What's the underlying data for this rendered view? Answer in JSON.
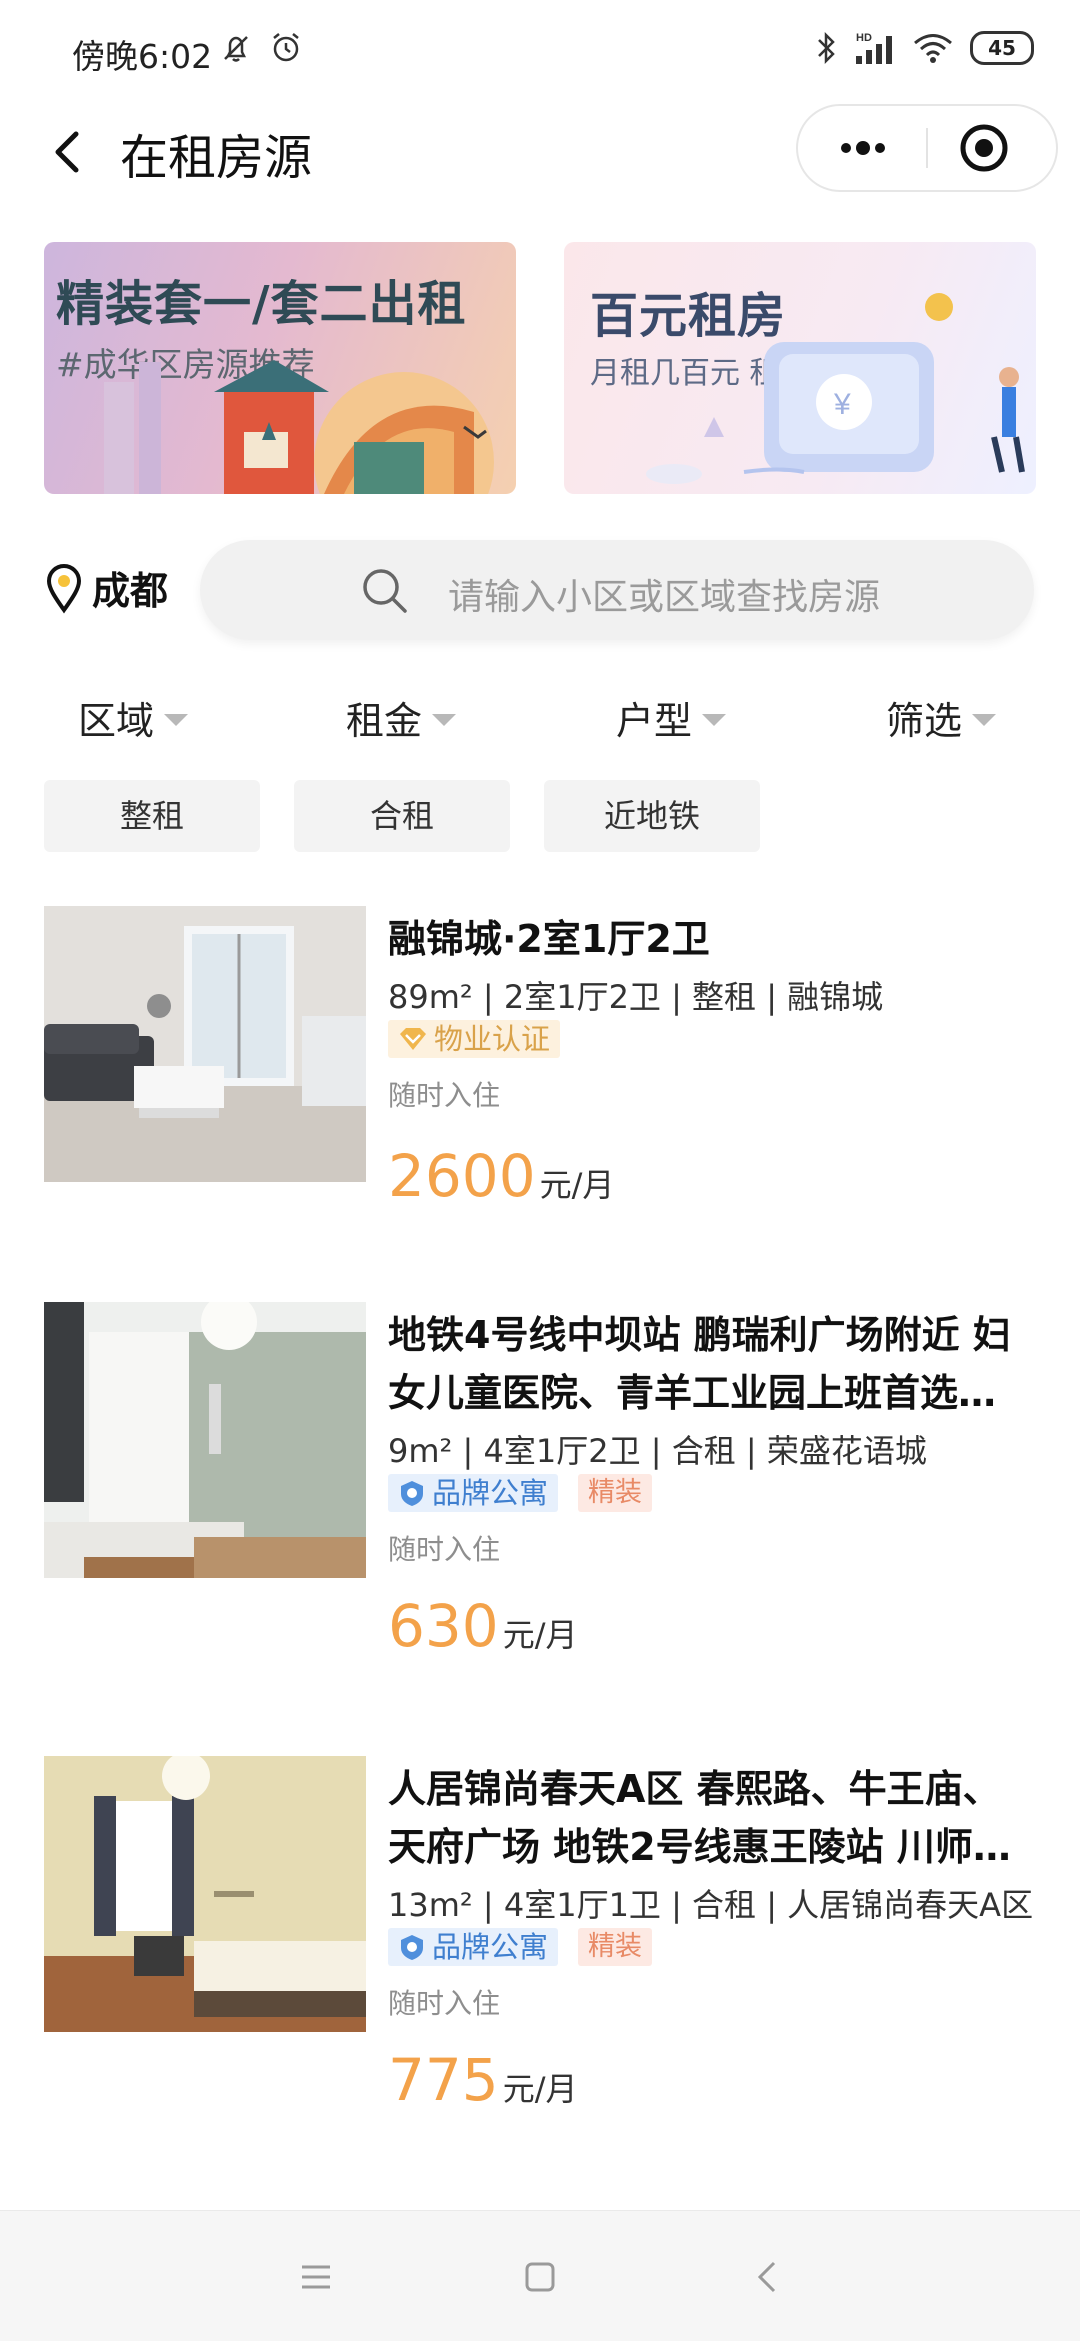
{
  "status_bar": {
    "time": "傍晚6:02",
    "battery": "45",
    "network": "HD"
  },
  "header": {
    "title": "在租房源"
  },
  "banners": [
    {
      "title": "精装套一/套二出租",
      "subtitle": "#成华区房源推荐"
    },
    {
      "title": "百元租房",
      "subtitle": "月租几百元 租到心仪好房"
    }
  ],
  "location": {
    "city": "成都"
  },
  "search": {
    "placeholder": "请输入小区或区域查找房源"
  },
  "filters": [
    "区域",
    "租金",
    "户型",
    "筛选"
  ],
  "tags": [
    "整租",
    "合租",
    "近地铁"
  ],
  "listings": [
    {
      "title": "融锦城·2室1厅2卫",
      "meta": "89m² | 2室1厅2卫 | 整租 | 融锦城",
      "badge": "物业认证",
      "availability": "随时入住",
      "price": "2600",
      "unit": "元/月"
    },
    {
      "title": "地铁4号线中坝站 鹏瑞利广场附近 妇女儿童医院、青羊工业园上班首选…",
      "meta": "9m² | 4室1厅2卫 | 合租 | 荣盛花语城",
      "badge": "品牌公寓",
      "tag": "精装",
      "availability": "随时入住",
      "price": "630",
      "unit": "元/月"
    },
    {
      "title": "人居锦尚春天A区 春熙路、牛王庙、天府广场 地铁2号线惠王陵站 川师…",
      "meta": "13m² | 4室1厅1卫 | 合租 | 人居锦尚春天A区",
      "badge": "品牌公寓",
      "tag": "精装",
      "availability": "随时入住",
      "price": "775",
      "unit": "元/月"
    }
  ],
  "colors": {
    "price": "#f3a24a",
    "gold_badge": "#d9a24a",
    "blue_badge": "#3f7fcf",
    "orange_tag": "#e88a66"
  }
}
